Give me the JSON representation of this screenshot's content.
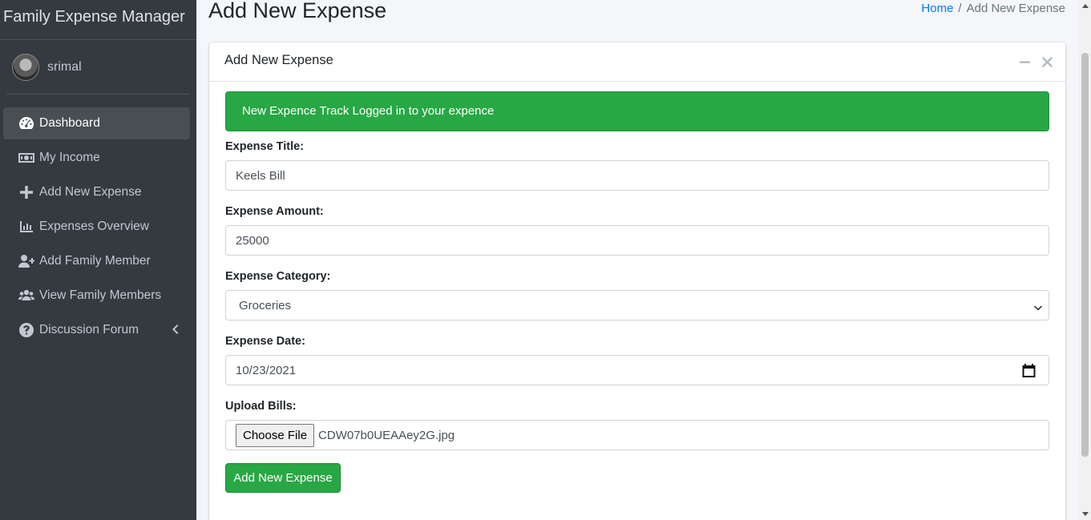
{
  "app": {
    "brand": "Family Expense Manager"
  },
  "user": {
    "name": "srimal"
  },
  "sidebar": {
    "items": [
      {
        "label": "Dashboard",
        "icon": "tachometer-icon",
        "active": true
      },
      {
        "label": "My Income",
        "icon": "money-bill-icon"
      },
      {
        "label": "Add New Expense",
        "icon": "plus-icon"
      },
      {
        "label": "Expenses Overview",
        "icon": "bar-chart-icon"
      },
      {
        "label": "Add Family Member",
        "icon": "user-plus-icon"
      },
      {
        "label": "View Family Members",
        "icon": "users-icon"
      },
      {
        "label": "Discussion Forum",
        "icon": "question-circle-icon",
        "has_submenu": true
      }
    ]
  },
  "header": {
    "title": "Add New Expense",
    "breadcrumb": {
      "home": "Home",
      "separator": "/",
      "current": "Add New Expense"
    }
  },
  "card": {
    "title": "Add New Expense",
    "alert": "New Expence Track Logged in to your expence",
    "form": {
      "title_label": "Expense Title:",
      "title_value": "Keels Bill",
      "amount_label": "Expense Amount:",
      "amount_value": "25000",
      "category_label": "Expense Category:",
      "category_value": "Groceries",
      "date_label": "Expense Date:",
      "date_value": "10/23/2021",
      "upload_label": "Upload Bills:",
      "file_button": "Choose File",
      "file_name": "CDW07b0UEAAey2G.jpg",
      "submit": "Add New Expense"
    }
  },
  "colors": {
    "sidebar": "#343a40",
    "success": "#28a745",
    "link": "#007bff"
  }
}
